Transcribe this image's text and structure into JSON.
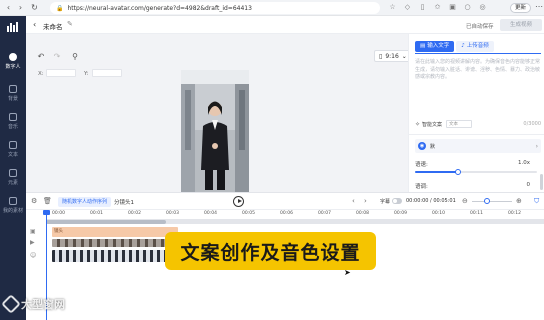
{
  "browser": {
    "url": "https://neural-avatar.com/generate?d=4982&draft_id=64413",
    "update_label": "更新"
  },
  "sidebar": {
    "items": [
      {
        "label": "数字人",
        "icon": "person-icon"
      },
      {
        "label": "背景",
        "icon": "background-icon"
      },
      {
        "label": "音乐",
        "icon": "music-icon"
      },
      {
        "label": "文本",
        "icon": "text-icon"
      },
      {
        "label": "元素",
        "icon": "element-icon"
      },
      {
        "label": "我的素材",
        "icon": "folder-icon"
      }
    ]
  },
  "header": {
    "title": "未命名",
    "saved_status": "已自动保存",
    "generate_label": "生成视频"
  },
  "canvas": {
    "x_label": "X:",
    "y_label": "Y:",
    "aspect_ratio": "9:16"
  },
  "script_panel": {
    "tab_text": "输入文字",
    "tab_audio": "上传音频",
    "placeholder": "请在此输入您的视频讲解内容。为确保音色内容能够正常生成，请勿输入脏话、诽谤、淫秽、色情、暴力、政治敏感或宗教内容。",
    "smart_copy_label": "智能文案",
    "smart_copy_select": "文本",
    "char_count": "0/3000",
    "voice_name": "默",
    "speed_label": "语速:",
    "speed_value": "1.0x",
    "speed_fraction": 0.35,
    "pitch_label": "语调:",
    "pitch_value": "0"
  },
  "timeline": {
    "action_seq_label": "随机数字人动作序列",
    "split_label": "分镜头1",
    "subtitle_label": "字幕",
    "time_display": "00:00:00 / 00:05:01",
    "ticks": [
      "00:00",
      "00:01",
      "00:02",
      "00:03",
      "00:04",
      "00:05",
      "00:06",
      "00:07",
      "00:08",
      "00:09",
      "00:10",
      "00:11",
      "00:12"
    ],
    "bg_track_label": "镜头"
  },
  "overlay": {
    "caption": "文案创作及音色设置",
    "watermark": "大型窗网"
  },
  "colors": {
    "accent": "#2f6bf2",
    "sidebar": "#1f2a44",
    "caption_bg": "#f5c400"
  }
}
